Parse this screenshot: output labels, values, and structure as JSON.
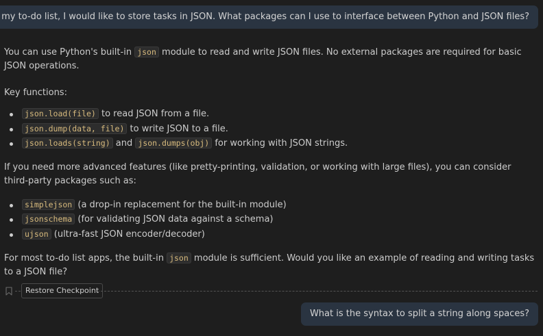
{
  "messages": {
    "user_1": "For my to-do list, I would like to store tasks in JSON. What packages can I use to interface between Python and JSON files?",
    "user_2": "What is the syntax to split a string along spaces?"
  },
  "assistant": {
    "intro_before": "You can use Python's built-in ",
    "intro_code": "json",
    "intro_after": " module to read and write JSON files. No external packages are required for basic JSON operations.",
    "key_functions": "Key functions:",
    "functions": [
      {
        "code": "json.load(file)",
        "text": " to read JSON from a file."
      },
      {
        "code": "json.dump(data, file)",
        "text": " to write JSON to a file."
      },
      {
        "code": "json.loads(string)",
        "mid": " and ",
        "code2": "json.dumps(obj)",
        "text": " for working with JSON strings."
      }
    ],
    "advanced": "If you need more advanced features (like pretty-printing, validation, or working with large files), you can consider third-party packages such as:",
    "packages": [
      {
        "code": "simplejson",
        "text": " (a drop-in replacement for the built-in module)"
      },
      {
        "code": "jsonschema",
        "text": " (for validating JSON data against a schema)"
      },
      {
        "code": "ujson",
        "text": " (ultra-fast JSON encoder/decoder)"
      }
    ],
    "closing_before": "For most to-do list apps, the built-in ",
    "closing_code": "json",
    "closing_after": " module is sufficient. Would you like an example of reading and writing tasks to a JSON file?"
  },
  "checkpoint": {
    "icon": "bookmark-icon",
    "label": "Restore Checkpoint"
  },
  "colors": {
    "background": "#1e1e1e",
    "user_bubble": "#2a3441",
    "inline_code": "#d7ba7d"
  }
}
